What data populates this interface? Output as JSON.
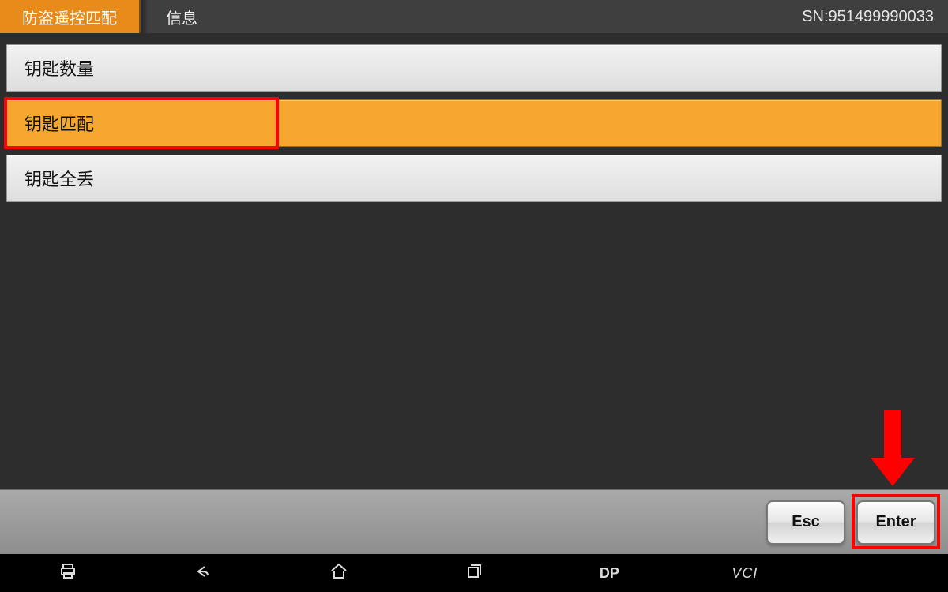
{
  "header": {
    "left_label": "防盗遥控匹配",
    "mid_label": "信息",
    "serial_label": "SN:951499990033"
  },
  "menu": {
    "items": [
      {
        "label": "钥匙数量",
        "selected": false
      },
      {
        "label": "钥匙匹配",
        "selected": true
      },
      {
        "label": "钥匙全丢",
        "selected": false
      }
    ]
  },
  "actions": {
    "esc_label": "Esc",
    "enter_label": "Enter"
  },
  "sysbar": {
    "dp_label": "DP",
    "vci_label": "VCI"
  },
  "annotations": {
    "highlight_menu_index": 1,
    "highlight_enter": true,
    "arrow_points_to": "enter-button"
  }
}
